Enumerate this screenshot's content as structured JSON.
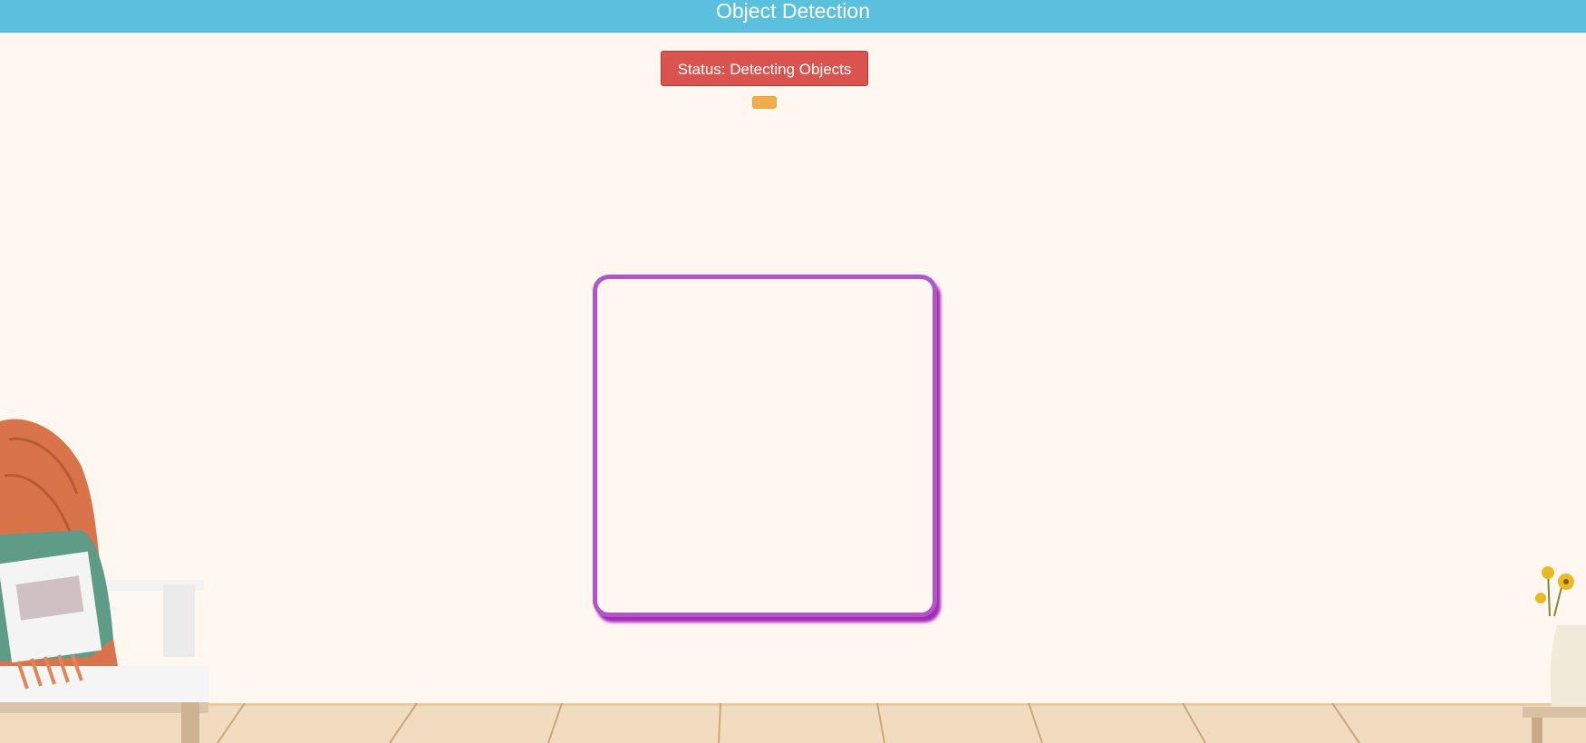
{
  "header": {
    "title": "Object Detection"
  },
  "status": {
    "label": "Status: Detecting Objects"
  },
  "colors": {
    "header_bg": "#5bc0de",
    "status_bg": "#d9534f",
    "indicator_bg": "#f0ad4e",
    "frame_border": "#b455c7",
    "page_bg": "#fff7f0"
  },
  "decorations": {
    "left": "bench-with-pillow-and-blanket",
    "right": "vase-with-sunflowers",
    "floor": "wooden-floor"
  }
}
